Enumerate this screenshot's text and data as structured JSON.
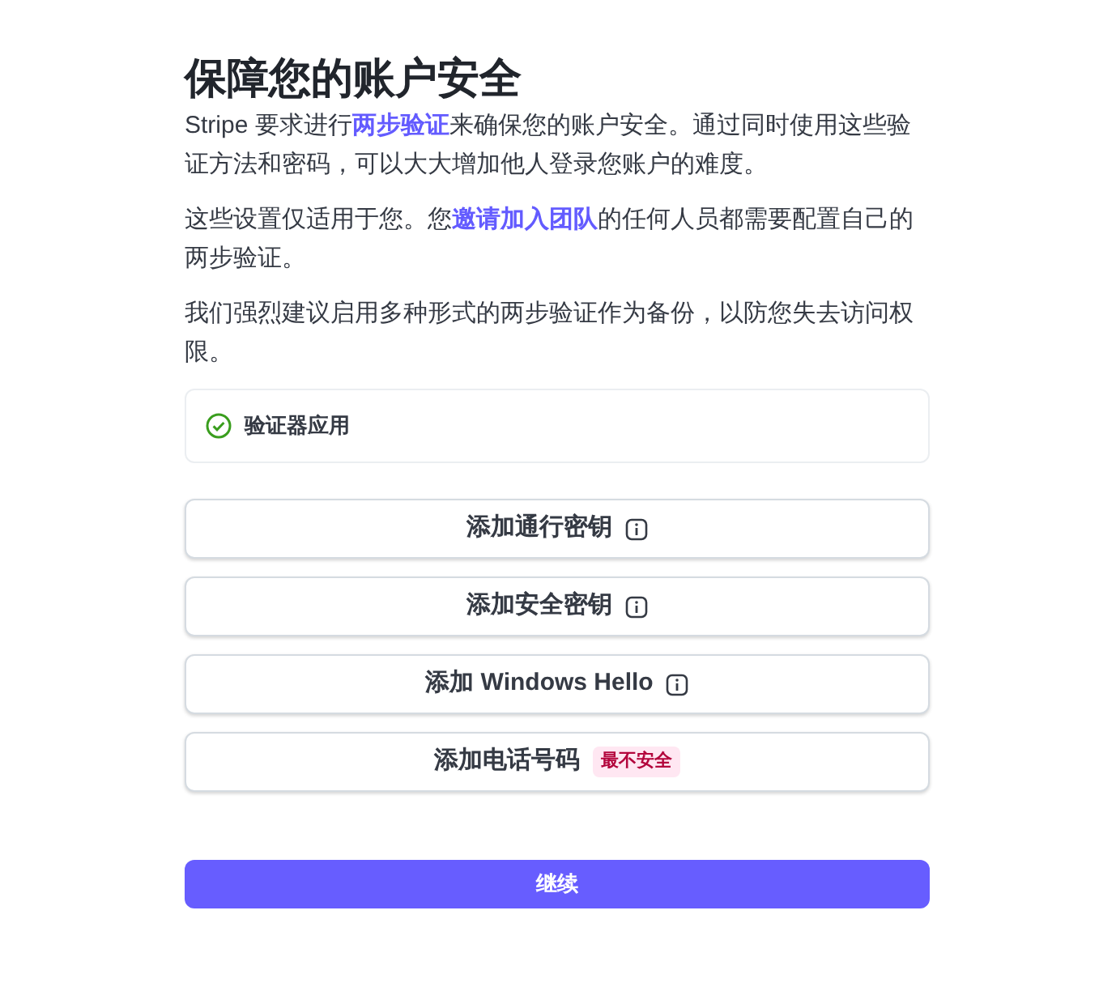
{
  "title": "保障您的账户安全",
  "paragraphs": [
    [
      {
        "kind": "text",
        "text": "Stripe 要求进行"
      },
      {
        "kind": "link",
        "text": "两步验证"
      },
      {
        "kind": "text",
        "text": "来确保您的账户安全。通过同时使用这些验证方法和密码，可以大大增加他人登录您账户的难度。"
      }
    ],
    [
      {
        "kind": "text",
        "text": "这些设置仅适用于您。您"
      },
      {
        "kind": "link",
        "text": "邀请加入团队"
      },
      {
        "kind": "text",
        "text": "的任何人员都需要配置自己的两步验证。"
      }
    ],
    [
      {
        "kind": "text",
        "text": "我们强烈建议启用多种形式的两步验证作为备份，以防您失去访问权限。"
      }
    ]
  ],
  "methods": [
    {
      "label": "验证器应用",
      "checked": true
    }
  ],
  "buttons": [
    {
      "kind": "info",
      "label": "添加通行密钥"
    },
    {
      "kind": "info",
      "label": "添加安全密钥"
    },
    {
      "kind": "info",
      "label": "添加 Windows Hello"
    },
    {
      "kind": "badge",
      "label": "添加电话号码",
      "badge": "最不安全"
    }
  ],
  "continue": "继续"
}
